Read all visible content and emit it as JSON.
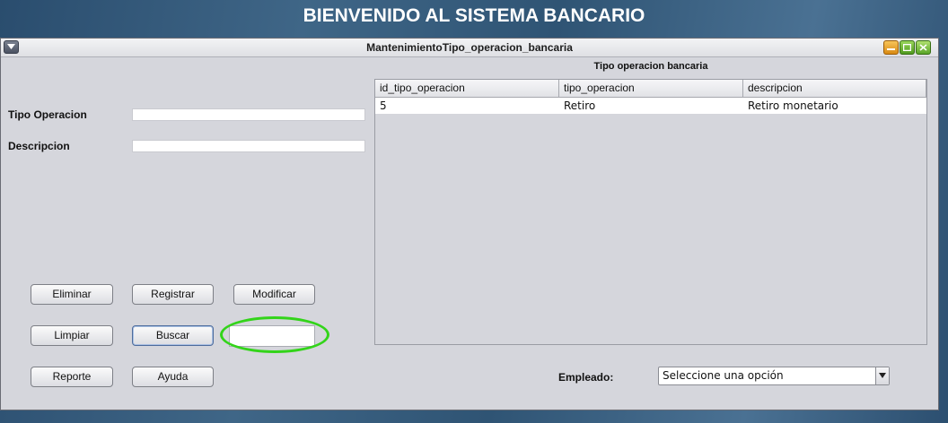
{
  "banner": {
    "title": "BIENVENIDO AL SISTEMA BANCARIO"
  },
  "window": {
    "title": "MantenimientoTipo_operacion_bancaria"
  },
  "form": {
    "tipo_operacion_label": "Tipo Operacion",
    "tipo_operacion_value": "",
    "descripcion_label": "Descripcion",
    "descripcion_value": ""
  },
  "buttons": {
    "eliminar": "Eliminar",
    "registrar": "Registrar",
    "modificar": "Modificar",
    "limpiar": "Limpiar",
    "buscar": "Buscar",
    "reporte": "Reporte",
    "ayuda": "Ayuda"
  },
  "search": {
    "value": ""
  },
  "table": {
    "title": "Tipo operacion bancaria",
    "columns": [
      "id_tipo_operacion",
      "tipo_operacion",
      "descripcion"
    ],
    "rows": [
      [
        "5",
        "Retiro",
        "Retiro monetario"
      ]
    ]
  },
  "empleado": {
    "label": "Empleado:",
    "selected": "Seleccione una opción"
  },
  "colors": {
    "highlight": "#33d41a",
    "window_bg": "#d5d6dc",
    "banner_text": "#ffffff"
  }
}
